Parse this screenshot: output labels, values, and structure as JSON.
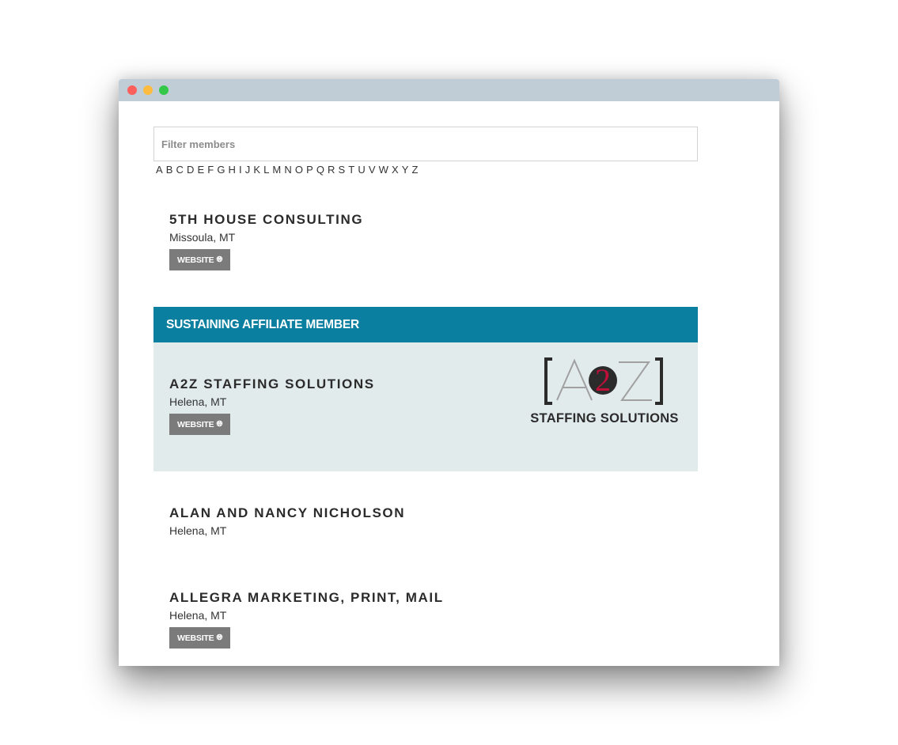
{
  "filter": {
    "placeholder": "Filter members"
  },
  "alphabet": [
    "A",
    "B",
    "C",
    "D",
    "E",
    "F",
    "G",
    "H",
    "I",
    "J",
    "K",
    "L",
    "M",
    "N",
    "O",
    "P",
    "Q",
    "R",
    "S",
    "T",
    "U",
    "V",
    "W",
    "X",
    "Y",
    "Z"
  ],
  "website_label": "WEBSITE",
  "members": [
    {
      "name": "5TH HOUSE CONSULTING",
      "location": "Missoula, MT",
      "has_website": true
    },
    {
      "name": "A2Z STAFFING SOLUTIONS",
      "location": "Helena, MT",
      "has_website": true,
      "featured": true
    },
    {
      "name": "ALAN AND NANCY NICHOLSON",
      "location": "Helena, MT",
      "has_website": false
    },
    {
      "name": "ALLEGRA MARKETING, PRINT, MAIL",
      "location": "Helena, MT",
      "has_website": true
    }
  ],
  "featured_section": {
    "header": "SUSTAINING AFFILIATE MEMBER"
  },
  "logo": {
    "mark": "A2Z",
    "subtitle": "STAFFING SOLUTIONS"
  },
  "colors": {
    "accent": "#0a7f9f",
    "featured_bg": "#e2ebec",
    "button": "#7b7b7b",
    "logo_red": "#c0103a"
  },
  "icons": {
    "website": "globe-icon"
  }
}
